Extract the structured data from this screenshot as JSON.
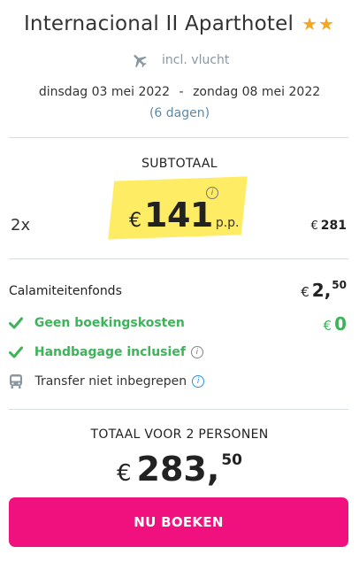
{
  "hotel": {
    "name": "Internacional II Aparthotel",
    "star_count": 2,
    "star_color": "#f5a623"
  },
  "flight": {
    "icon": "airplane-icon",
    "label": "incl. vlucht"
  },
  "dates": {
    "start": "dinsdag 03 mei 2022",
    "separator": "-",
    "end": "zondag 08 mei 2022",
    "duration": "(6 dagen)"
  },
  "subtotal": {
    "heading": "SUBTOTAAL",
    "quantity": "2x",
    "currency": "€",
    "price_per_person": "141",
    "per_person_label": "p.p.",
    "row_total_currency": "€",
    "row_total": "281"
  },
  "fees": {
    "calamity_label": "Calamiteitenfonds",
    "calamity_currency": "€",
    "calamity_whole": "2,",
    "calamity_cents": "50",
    "booking_costs_label": "Geen boekingskosten",
    "booking_costs_currency": "€",
    "booking_costs_value": "0",
    "hand_luggage_label": "Handbagage inclusief",
    "transfer_label": "Transfer niet inbegrepen",
    "green_color": "#3db35a"
  },
  "total": {
    "heading": "TOTAAL VOOR 2 PERSONEN",
    "currency": "€",
    "whole": "283,",
    "cents": "50"
  },
  "cta": {
    "label": "NU BOEKEN",
    "color": "#f0117f"
  }
}
